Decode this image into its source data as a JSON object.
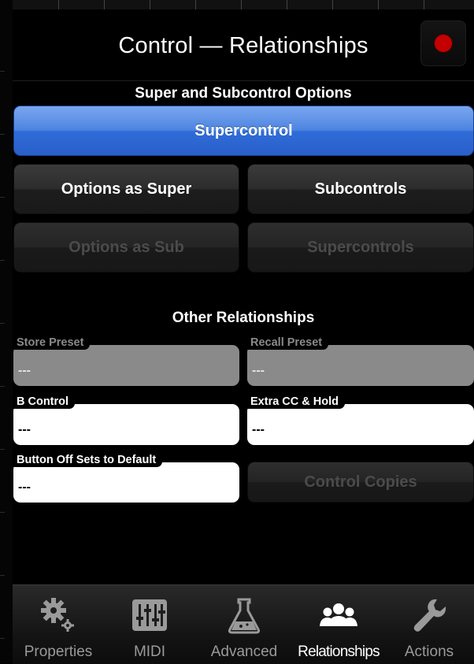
{
  "header": {
    "title": "Control — Relationships",
    "record_icon": "record-dot-icon"
  },
  "supersub": {
    "heading": "Super and Subcontrol Options",
    "mode_button": "Supercontrol",
    "options_as_super": "Options as Super",
    "subcontrols": "Subcontrols",
    "options_as_sub": "Options as Sub",
    "supercontrols": "Supercontrols"
  },
  "other": {
    "heading": "Other Relationships",
    "store_preset": {
      "label": "Store Preset",
      "value": "---"
    },
    "recall_preset": {
      "label": "Recall Preset",
      "value": "---"
    },
    "b_control": {
      "label": "B Control",
      "value": "---"
    },
    "extra_cc_hold": {
      "label": "Extra CC & Hold",
      "value": "---"
    },
    "button_off_default": {
      "label": "Button Off Sets to Default",
      "value": "---"
    },
    "control_copies": "Control Copies"
  },
  "tabs": [
    {
      "label": "Properties",
      "icon": "gears-icon",
      "active": false
    },
    {
      "label": "MIDI",
      "icon": "mixer-sliders-icon",
      "active": false
    },
    {
      "label": "Advanced",
      "icon": "flask-icon",
      "active": false
    },
    {
      "label": "Relationships",
      "icon": "people-icon",
      "active": true
    },
    {
      "label": "Actions",
      "icon": "wrench-icon",
      "active": false
    }
  ],
  "colors": {
    "accent_blue": "#3a74dc",
    "record_red": "#c40000"
  }
}
